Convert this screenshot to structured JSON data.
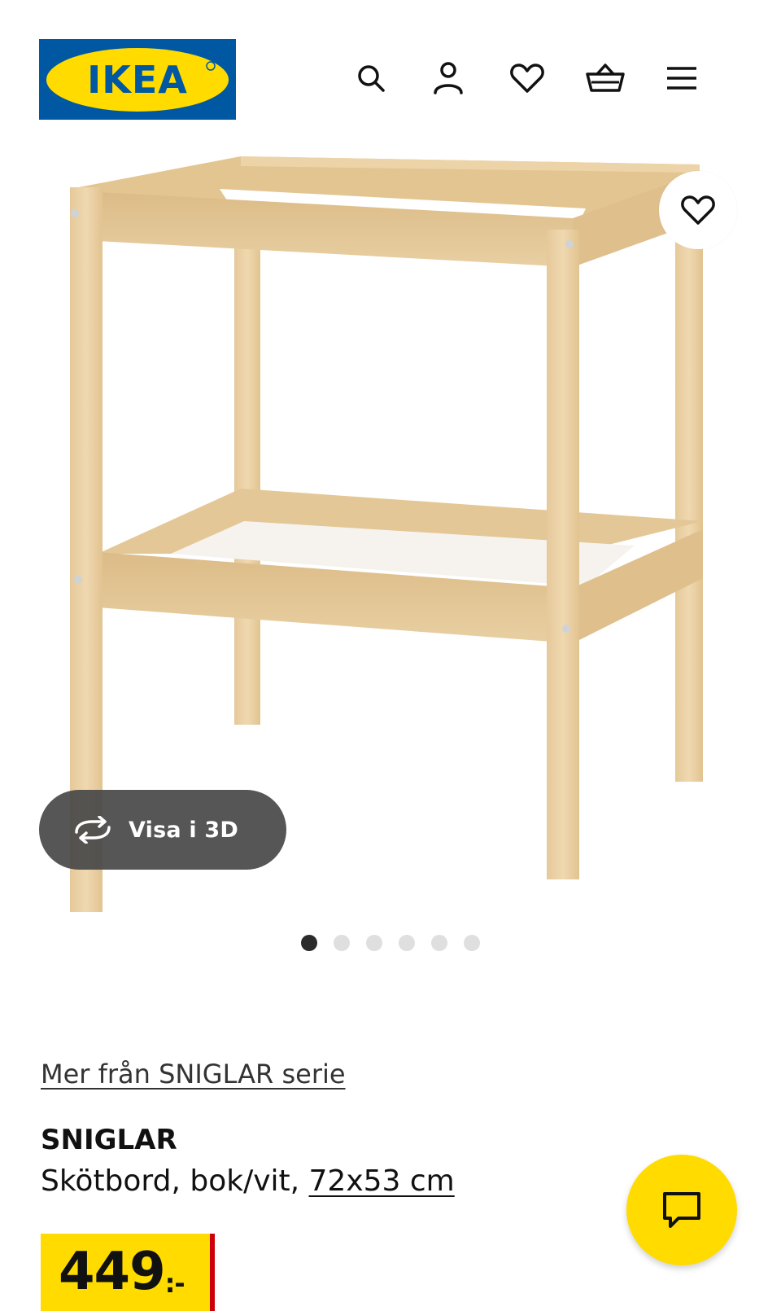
{
  "header": {
    "logo_text": "IKEA",
    "icons": [
      "search-icon",
      "account-icon",
      "favourites-icon",
      "cart-icon",
      "menu-icon"
    ]
  },
  "gallery": {
    "view_3d_label": "Visa i 3D",
    "image_count": 6,
    "active_image": 1
  },
  "product": {
    "series_link": "Mer från SNIGLAR serie",
    "name": "SNIGLAR",
    "description": "Skötbord, bok/vit,",
    "dimensions": "72x53 cm",
    "price_main": "449",
    "price_suffix": ":-"
  },
  "colors": {
    "brand_blue": "#0058a3",
    "brand_yellow": "#ffdb00",
    "price_accent": "#cc0008",
    "wood": "#e8cfa3"
  }
}
